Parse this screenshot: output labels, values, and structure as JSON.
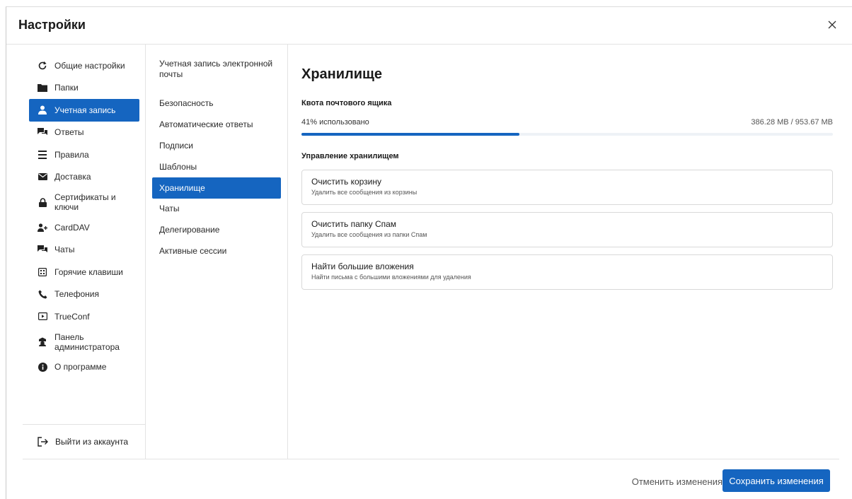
{
  "window": {
    "title": "Настройки",
    "close_icon": "close-icon"
  },
  "sidebar": {
    "items": [
      {
        "label": "Общие настройки",
        "icon": "refresh-icon"
      },
      {
        "label": "Папки",
        "icon": "folder-icon"
      },
      {
        "label": "Учетная запись",
        "icon": "user-icon",
        "active": true
      },
      {
        "label": "Ответы",
        "icon": "chat-icon"
      },
      {
        "label": "Правила",
        "icon": "list-icon"
      },
      {
        "label": "Доставка",
        "icon": "mail-icon"
      },
      {
        "label": "Сертификаты и ключи",
        "icon": "lock-icon"
      },
      {
        "label": "CardDAV",
        "icon": "contacts-icon"
      },
      {
        "label": "Чаты",
        "icon": "chat-icon"
      },
      {
        "label": "Горячие клавиши",
        "icon": "keyboard-icon"
      },
      {
        "label": "Телефония",
        "icon": "phone-icon"
      },
      {
        "label": "TrueConf",
        "icon": "video-icon"
      },
      {
        "label": "Панель администратора",
        "icon": "admin-icon"
      },
      {
        "label": "О программе",
        "icon": "info-icon"
      }
    ],
    "logout_label": "Выйти из аккаунта"
  },
  "subnav": {
    "items": [
      {
        "label": "Учетная запись электронной почты"
      },
      {
        "label": "Безопасность"
      },
      {
        "label": "Автоматические ответы"
      },
      {
        "label": "Подписи"
      },
      {
        "label": "Шаблоны"
      },
      {
        "label": "Хранилище",
        "active": true
      },
      {
        "label": "Чаты"
      },
      {
        "label": "Делегирование"
      },
      {
        "label": "Активные сессии"
      }
    ]
  },
  "main": {
    "title": "Хранилище",
    "quota_heading": "Квота почтового ящика",
    "used_text": "41% использовано",
    "used_fraction": 0.41,
    "size_text": "386.28 MB / 953.67 MB",
    "manage_heading": "Управление хранилищем",
    "actions": [
      {
        "title": "Очистить корзину",
        "subtitle": "Удалить все сообщения из корзины"
      },
      {
        "title": "Очистить папку Спам",
        "subtitle": "Удалить все сообщения из папки Спам"
      },
      {
        "title": "Найти большие вложения",
        "subtitle": "Найти письма с большими вложениями для удаления"
      }
    ]
  },
  "footer": {
    "cancel_label": "Отменить изменения",
    "save_label": "Сохранить изменения"
  },
  "colors": {
    "accent": "#1565c0"
  }
}
